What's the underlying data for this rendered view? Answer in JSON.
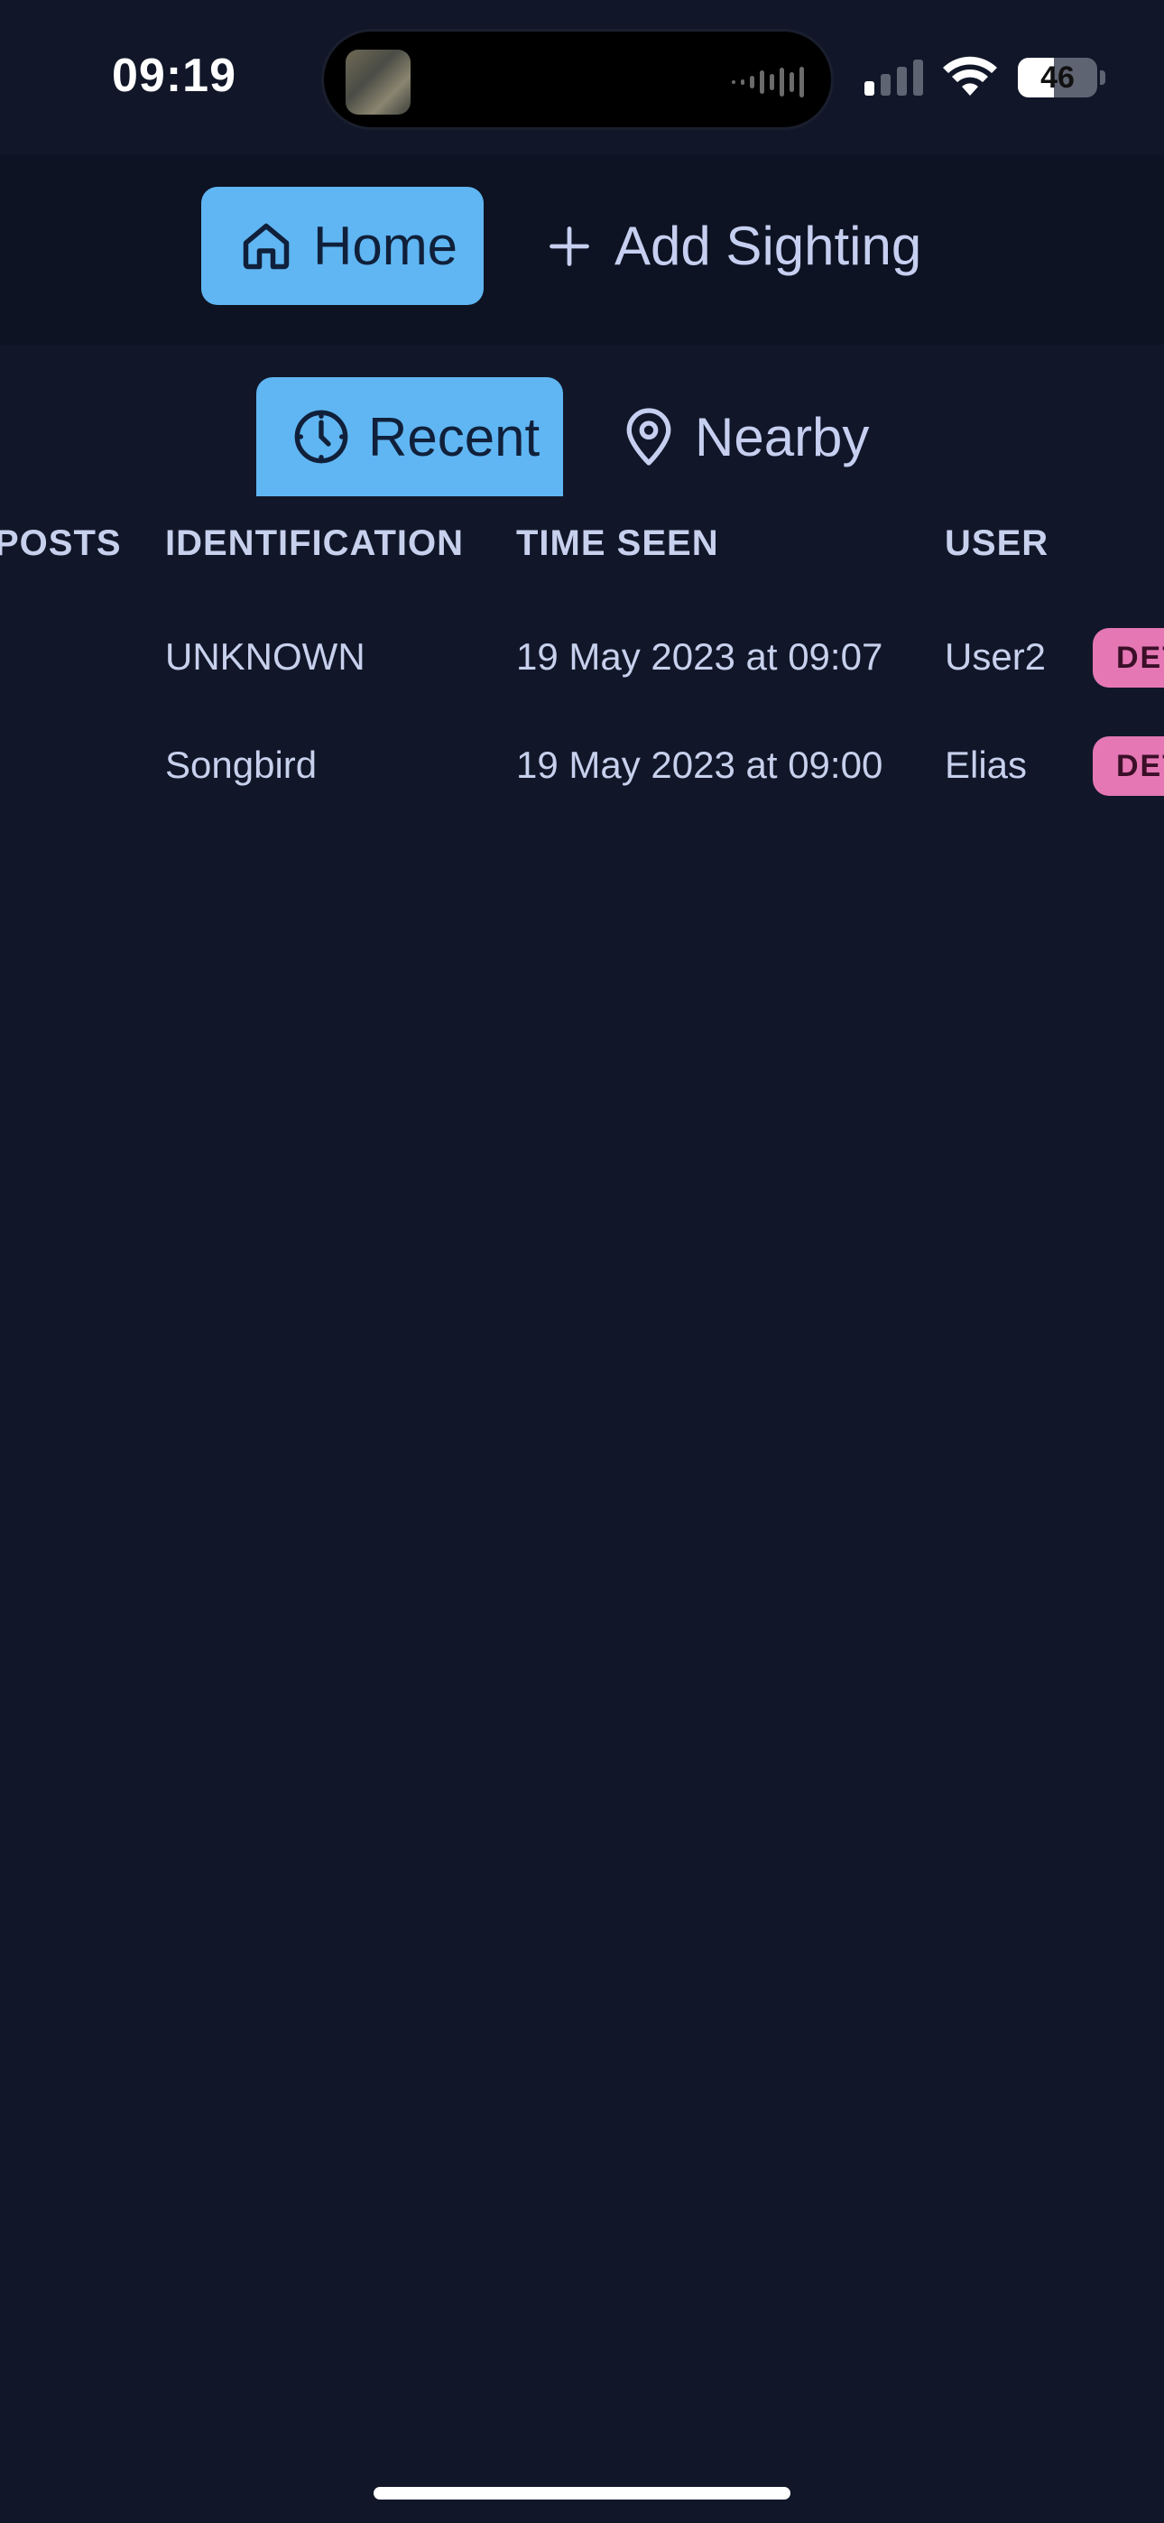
{
  "status_bar": {
    "time": "09:19",
    "battery": "46",
    "icons": [
      "dynamic-island-thumbnail",
      "audio-wave-icon",
      "cellular-signal-icon",
      "wifi-icon",
      "battery-icon"
    ]
  },
  "nav": {
    "home_label": "Home",
    "home_icon": "home-icon",
    "add_label": "Add Sighting",
    "add_icon": "plus-icon",
    "active": "Home",
    "active_color": "#60b6f2"
  },
  "tabs": {
    "recent_label": "Recent",
    "recent_icon": "clock-icon",
    "nearby_label": "Nearby",
    "nearby_icon": "map-pin-icon",
    "active": "Recent"
  },
  "table": {
    "columns": [
      "POSTS",
      "IDENTIFICATION",
      "TIME SEEN",
      "USER"
    ],
    "rows": [
      {
        "posts": "",
        "identification": "UNKNOWN",
        "time_seen": "19 May 2023 at 09:07",
        "user": "User2",
        "action": "DET"
      },
      {
        "posts": "",
        "identification": "Songbird",
        "time_seen": "19 May 2023 at 09:00",
        "user": "Elias",
        "action": "DET"
      }
    ]
  },
  "colors": {
    "background": "#111729",
    "nav_background": "#0d1322",
    "accent": "#60b6f2",
    "badge": "#e477b4",
    "text": "#c7d0ec"
  }
}
